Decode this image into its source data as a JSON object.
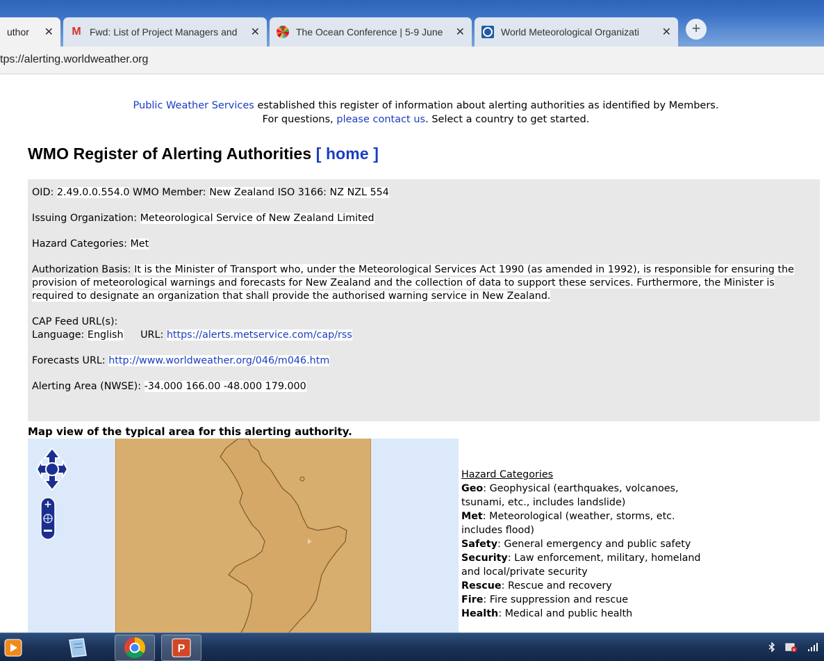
{
  "browser": {
    "tabs": [
      {
        "title": "uthor",
        "icon": "document-icon",
        "active": true
      },
      {
        "title": "Fwd: List of Project Managers and",
        "icon": "gmail-icon",
        "active": false
      },
      {
        "title": "The Ocean Conference | 5-9 June",
        "icon": "ocean-conference-icon",
        "active": false
      },
      {
        "title": "World Meteorological Organizati",
        "icon": "wmo-icon",
        "active": false
      }
    ],
    "new_tab_label": "+",
    "close_label": "✕",
    "url": "tps://alerting.worldweather.org"
  },
  "intro": {
    "link_pws": "Public Weather Services",
    "text1": " established this register of information about alerting authorities as identified by Members.",
    "text2_pre": "For questions, ",
    "link_contact": "please contact us",
    "text2_post": ". Select a country to get started."
  },
  "title": {
    "main": "WMO Register of Alerting Authorities",
    "home_link": "[ home ]"
  },
  "details": {
    "oid_label": "OID:",
    "oid": "2.49.0.0.554.0",
    "member_label": "WMO Member:",
    "member": "New Zealand",
    "iso_label": "ISO 3166:",
    "iso": "NZ NZL 554",
    "org_label": "Issuing Organization:",
    "org": "Meteorological Service of New Zealand Limited",
    "hazard_label": "Hazard Categories:",
    "hazard": "Met",
    "basis_label": "Authorization Basis:",
    "basis": "It is the Minister of Transport who, under the Meteorological Services Act 1990 (as amended in 1992), is responsible for ensuring the provision of meteorological warnings and forecasts for New Zealand and the collection of data to support these services. Furthermore, the Minister is required to designate an organization that shall provide the authorised warning service in New Zealand.",
    "cap_label": "CAP Feed URL(s):",
    "language_label": "Language:",
    "language": "English",
    "url_label": "URL:",
    "cap_url": "https://alerts.metservice.com/cap/rss",
    "forecast_label": "Forecasts URL:",
    "forecast_url": "http://www.worldweather.org/046/m046.htm",
    "area_label": "Alerting Area (NWSE):",
    "area": "-34.000 166.00 -48.000 179.000"
  },
  "map": {
    "caption": "Map view of the typical area for this alerting authority."
  },
  "legend": {
    "heading": "Hazard Categories",
    "items": [
      {
        "name": "Geo",
        "desc": ": Geophysical (earthquakes, volcanoes, tsunami, etc., includes landslide)"
      },
      {
        "name": "Met",
        "desc": ": Meteorological (weather, storms, etc. includes flood)"
      },
      {
        "name": "Safety",
        "desc": ": General emergency and public safety"
      },
      {
        "name": "Security",
        "desc": ": Law enforcement, military, homeland and local/private security"
      },
      {
        "name": "Rescue",
        "desc": ": Rescue and recovery"
      },
      {
        "name": "Fire",
        "desc": ": Fire suppression and rescue"
      },
      {
        "name": "Health",
        "desc": ": Medical and public health"
      }
    ]
  },
  "colors": {
    "link": "#1a3dc1",
    "infobox_bg": "#e8e8e8",
    "map_water": "#dbe9fb",
    "map_land": "#d8ae6e",
    "map_controls": "#1a2f8f"
  }
}
